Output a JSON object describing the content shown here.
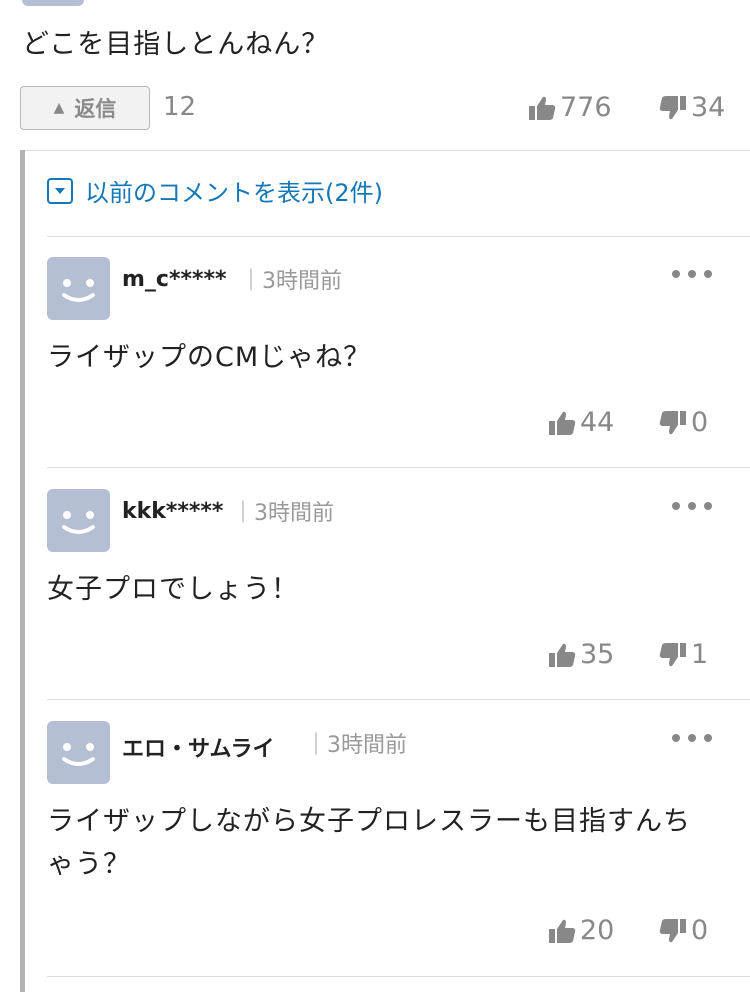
{
  "parent": {
    "text": "どこを目指しとんねん？",
    "reply_label": "返信",
    "reply_count": "12",
    "likes": "776",
    "dislikes": "34"
  },
  "thread": {
    "show_previous": "以前のコメントを表示(2件)"
  },
  "comments": [
    {
      "user": "m_c*****",
      "time": "3時間前",
      "text": "ライザップのCMじゃね？",
      "likes": "44",
      "dislikes": "0"
    },
    {
      "user": "kkk*****",
      "time": "3時間前",
      "text": "女子プロでしょう！",
      "likes": "35",
      "dislikes": "1"
    },
    {
      "user": "エロ・サムライ",
      "time": "3時間前",
      "text": "ライザップしながら女子プロレスラーも目指すんちゃう？",
      "likes": "20",
      "dislikes": "0"
    }
  ],
  "colors": {
    "link_blue": "#1478b8",
    "avatar_bg": "#b4bfd3",
    "muted_gray": "#888888"
  }
}
